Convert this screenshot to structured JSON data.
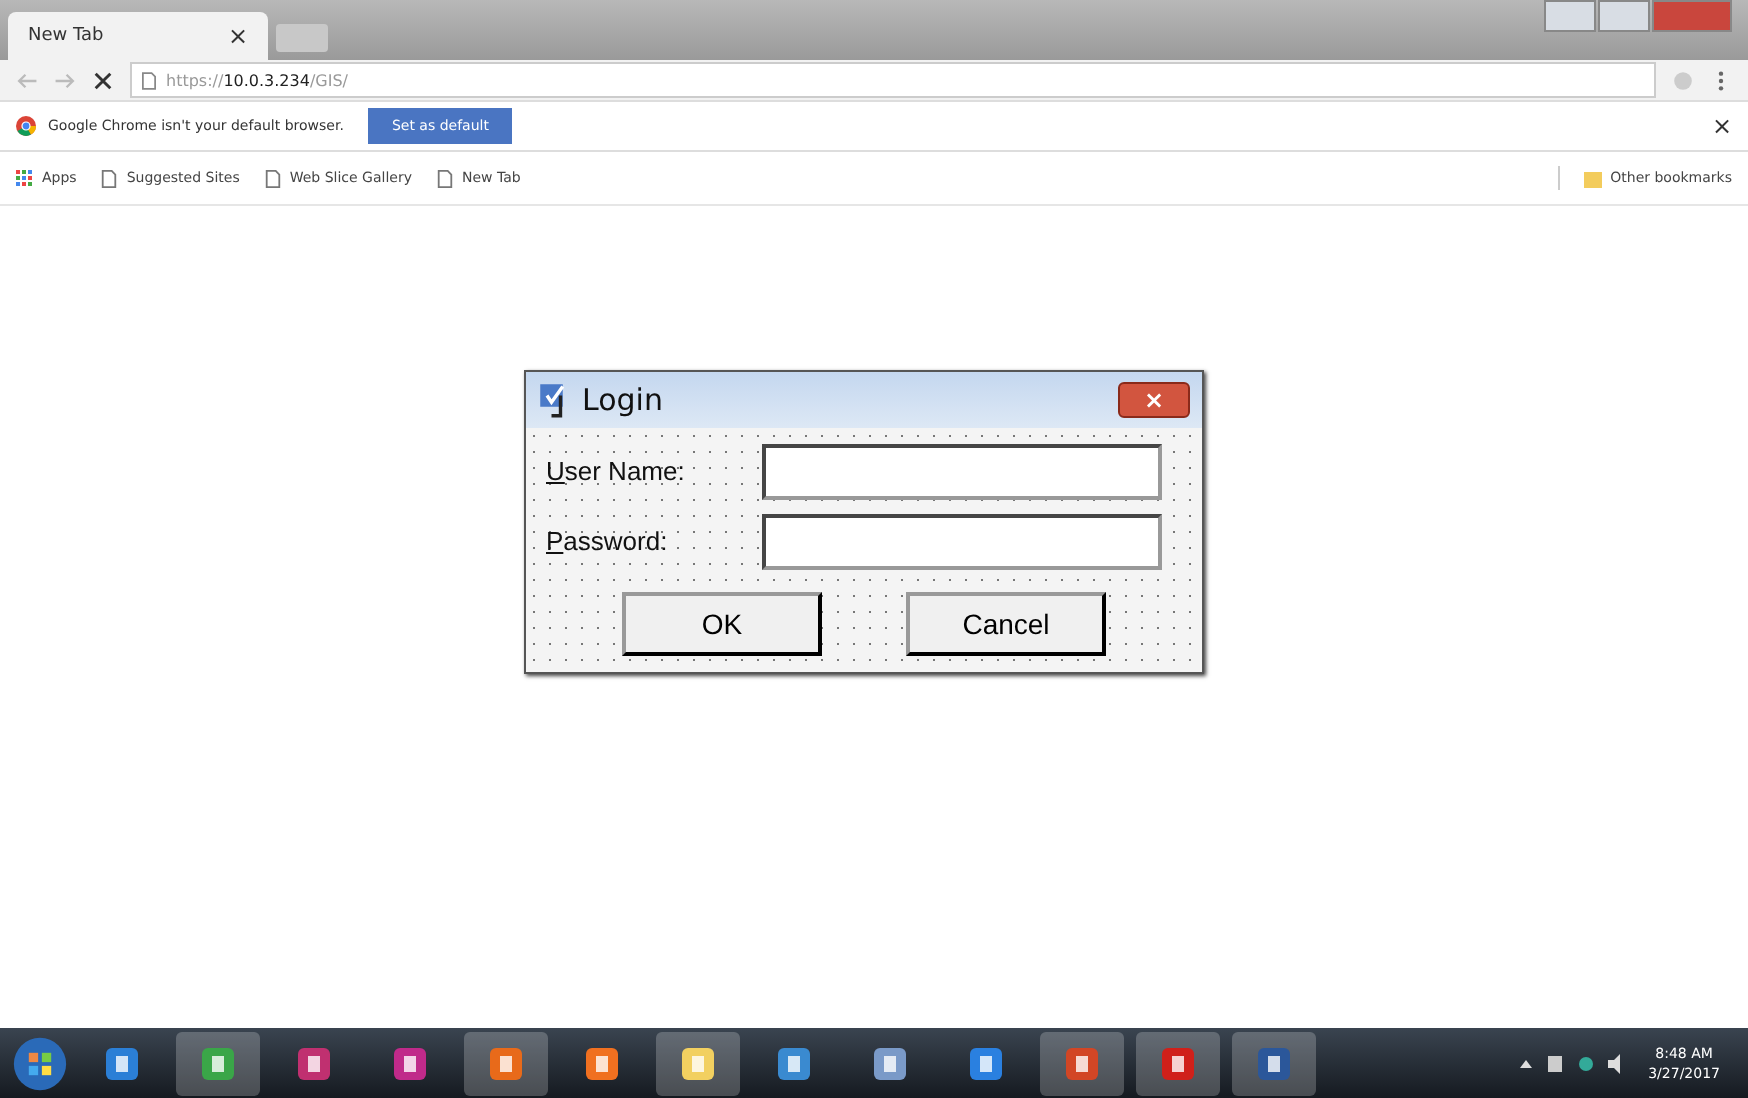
{
  "browser": {
    "tab": {
      "title": "New Tab",
      "close": "×"
    },
    "address": {
      "scheme": "https://",
      "host": "10.0.3.234",
      "path": "/GIS/"
    },
    "infobar": {
      "message": "Google Chrome isn't your default browser.",
      "button": "Set as default",
      "close": "×"
    },
    "bookmarks": [
      {
        "label": "Apps",
        "kind": "apps"
      },
      {
        "label": "Suggested Sites",
        "kind": "page"
      },
      {
        "label": "Web Slice Gallery",
        "kind": "page"
      },
      {
        "label": "New Tab",
        "kind": "page"
      }
    ],
    "other_bookmarks": "Other bookmarks"
  },
  "dialog": {
    "title": "Login",
    "close": "×",
    "fields": [
      {
        "label": "User Name:"
      },
      {
        "label": "Password:"
      }
    ],
    "buttons": [
      "OK",
      "Cancel"
    ]
  },
  "taskbar": {
    "apps": [
      {
        "kind": "media",
        "running": false
      },
      {
        "kind": "chrome",
        "running": true
      },
      {
        "kind": "paint",
        "running": false
      },
      {
        "kind": "pdf",
        "running": false
      },
      {
        "kind": "firefox",
        "running": true
      },
      {
        "kind": "xampp",
        "running": false
      },
      {
        "kind": "folder",
        "running": true
      },
      {
        "kind": "tool",
        "running": false
      },
      {
        "kind": "network",
        "running": false
      },
      {
        "kind": "snip",
        "running": false
      },
      {
        "kind": "powerpoint",
        "running": true
      },
      {
        "kind": "acrobat",
        "running": true
      },
      {
        "kind": "word",
        "running": true
      }
    ],
    "time": "8:48 AM",
    "date": "3/27/2017"
  }
}
